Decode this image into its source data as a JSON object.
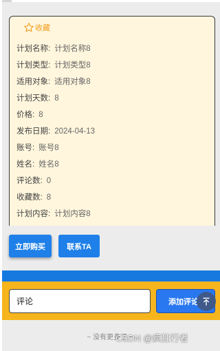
{
  "favorite": {
    "label": "收藏",
    "icon": "star-outline-icon",
    "color": "#f29b1a"
  },
  "fields": [
    {
      "label": "计划名称:",
      "value": "计划名称8"
    },
    {
      "label": "计划类型:",
      "value": "计划类型8"
    },
    {
      "label": "适用对象:",
      "value": "适用对象8"
    },
    {
      "label": "计划天数:",
      "value": "8"
    },
    {
      "label": "价格:",
      "value": "8"
    },
    {
      "label": "发布日期:",
      "value": "2024-04-13"
    },
    {
      "label": "账号:",
      "value": "账号8"
    },
    {
      "label": "姓名:",
      "value": "姓名8"
    },
    {
      "label": "评论数:",
      "value": "0"
    },
    {
      "label": "收藏数:",
      "value": "8"
    },
    {
      "label": "计划内容:",
      "value": "计划内容8"
    }
  ],
  "actions": {
    "buy_label": "立即购买",
    "contact_label": "联系TA"
  },
  "comment": {
    "placeholder": "评论",
    "submit_label": "添加评论"
  },
  "back_to_top_icon": "arrow-up-to-top-icon",
  "footer": {
    "no_more": "~ 没有更多了 ~",
    "watermark": "CSDN @疯狂行者"
  },
  "colors": {
    "card_bg": "#fff6dd",
    "primary_blue": "#1e80e8",
    "comment_bar": "#f7b51d",
    "accent": "#f29b1a"
  }
}
